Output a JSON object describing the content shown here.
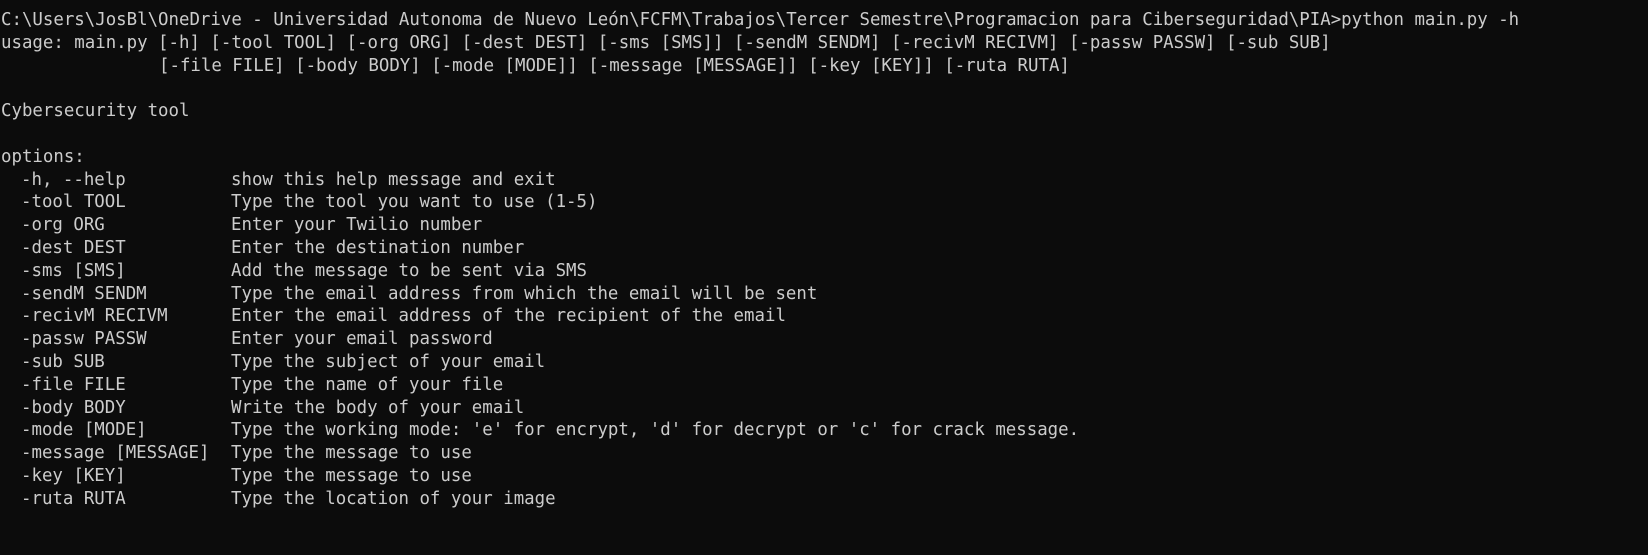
{
  "terminal": {
    "prompt_line": "C:\\Users\\JosBl\\OneDrive - Universidad Autonoma de Nuevo León\\FCFM\\Trabajos\\Tercer Semestre\\Programacion para Ciberseguridad\\PIA>python main.py -h",
    "usage_line1": "usage: main.py [-h] [-tool TOOL] [-org ORG] [-dest DEST] [-sms [SMS]] [-sendM SENDM] [-recivM RECIVM] [-passw PASSW] [-sub SUB]",
    "usage_line2": "[-file FILE] [-body BODY] [-mode [MODE]] [-message [MESSAGE]] [-key [KEY]] [-ruta RUTA]",
    "description": "Cybersecurity tool",
    "options_header": "options:",
    "options": [
      {
        "flag": "-h, --help",
        "desc": "show this help message and exit"
      },
      {
        "flag": "-tool TOOL",
        "desc": "Type the tool you want to use (1-5)"
      },
      {
        "flag": "-org ORG",
        "desc": "Enter your Twilio number"
      },
      {
        "flag": "-dest DEST",
        "desc": "Enter the destination number"
      },
      {
        "flag": "-sms [SMS]",
        "desc": "Add the message to be sent via SMS"
      },
      {
        "flag": "-sendM SENDM",
        "desc": "Type the email address from which the email will be sent"
      },
      {
        "flag": "-recivM RECIVM",
        "desc": "Enter the email address of the recipient of the email"
      },
      {
        "flag": "-passw PASSW",
        "desc": "Enter your email password"
      },
      {
        "flag": "-sub SUB",
        "desc": "Type the subject of your email"
      },
      {
        "flag": "-file FILE",
        "desc": "Type the name of your file"
      },
      {
        "flag": "-body BODY",
        "desc": "Write the body of your email"
      },
      {
        "flag": "-mode [MODE]",
        "desc": "Type the working mode: 'e' for encrypt, 'd' for decrypt or 'c' for crack message."
      },
      {
        "flag": "-message [MESSAGE]",
        "desc": "Type the message to use"
      },
      {
        "flag": "-key [KEY]",
        "desc": "Type the message to use"
      },
      {
        "flag": "-ruta RUTA",
        "desc": "Type the location of your image"
      }
    ]
  }
}
